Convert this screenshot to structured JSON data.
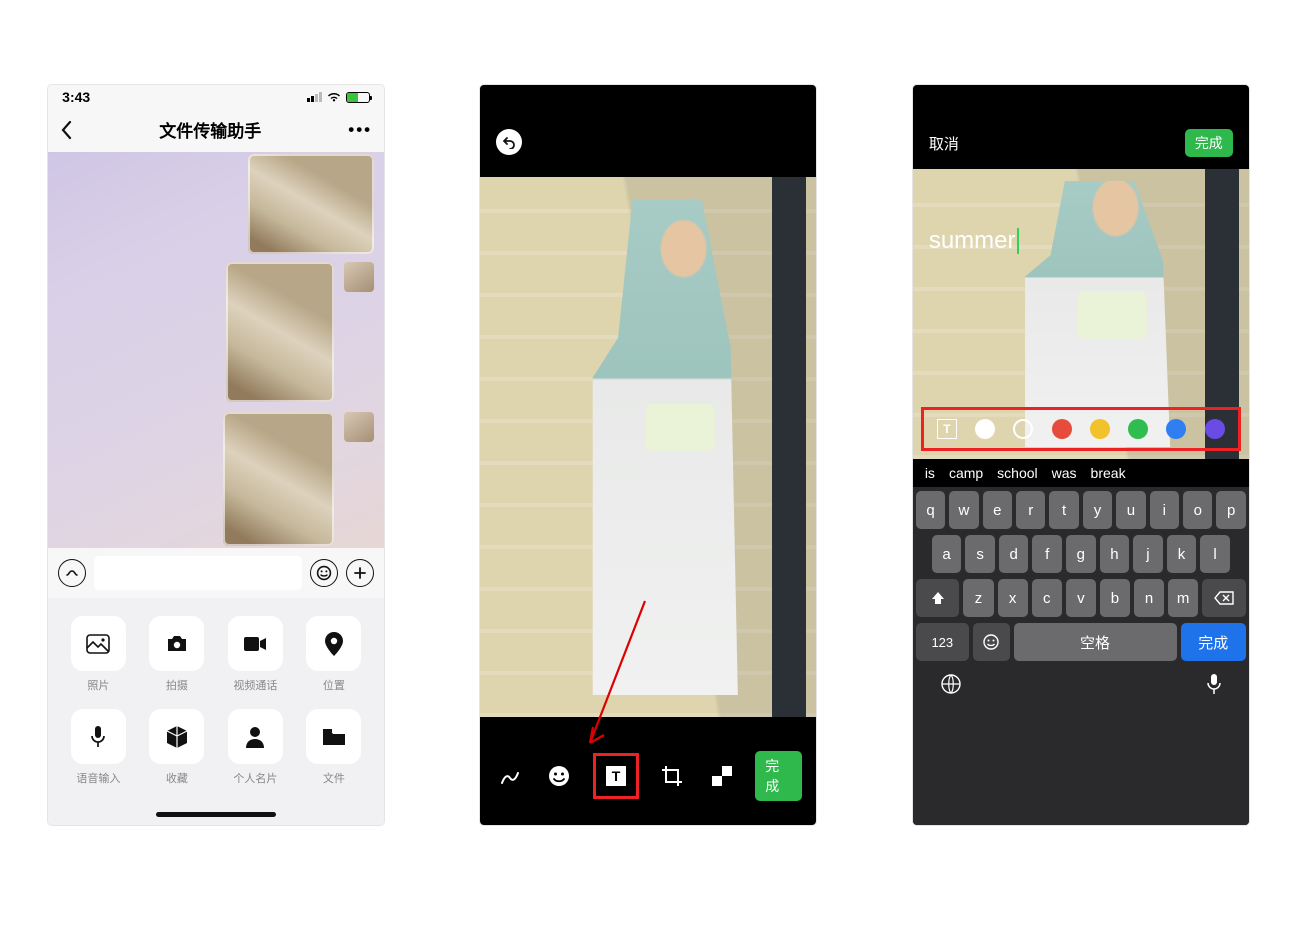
{
  "phone1": {
    "statusbar": {
      "time": "3:43"
    },
    "nav": {
      "title": "文件传输助手"
    },
    "attach": {
      "items": [
        {
          "label": "照片"
        },
        {
          "label": "拍摄"
        },
        {
          "label": "视频通话"
        },
        {
          "label": "位置"
        },
        {
          "label": "语音输入"
        },
        {
          "label": "收藏"
        },
        {
          "label": "个人名片"
        },
        {
          "label": "文件"
        }
      ]
    }
  },
  "phone2": {
    "done_label": "完成"
  },
  "phone3": {
    "cancel": "取消",
    "done": "完成",
    "typed_text": "summer",
    "colors": [
      "#ffffff",
      "transparent",
      "#e64b3c",
      "#f2c22b",
      "#2fbd50",
      "#2f7ef2",
      "#6b4be6"
    ],
    "suggestions": [
      "is",
      "camp",
      "school",
      "was",
      "break"
    ],
    "keyboard": {
      "row1": [
        "q",
        "w",
        "e",
        "r",
        "t",
        "y",
        "u",
        "i",
        "o",
        "p"
      ],
      "row2": [
        "a",
        "s",
        "d",
        "f",
        "g",
        "h",
        "j",
        "k",
        "l"
      ],
      "row3": [
        "z",
        "x",
        "c",
        "v",
        "b",
        "n",
        "m"
      ],
      "numkey": "123",
      "space": "空格",
      "done": "完成"
    }
  }
}
